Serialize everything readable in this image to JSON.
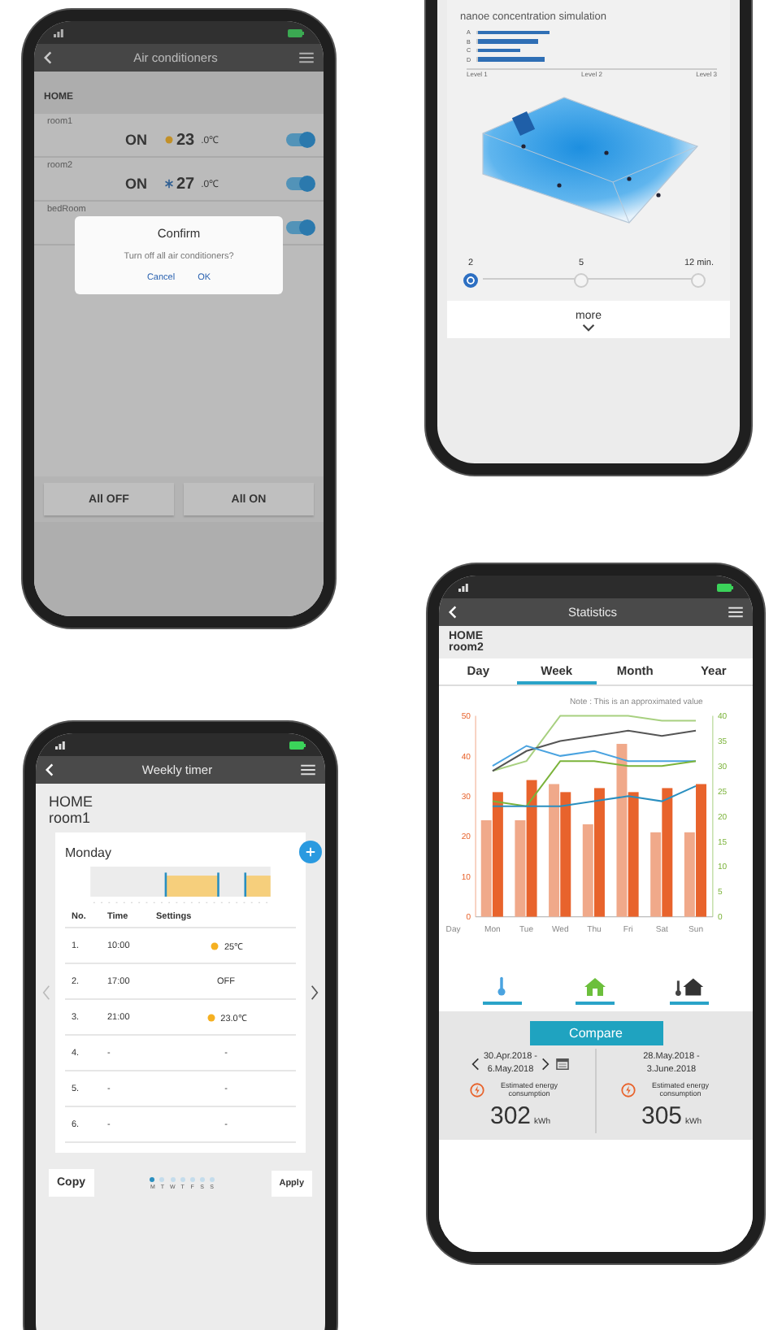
{
  "air_conditioners_screen": {
    "title": "Air conditioners",
    "group": "HOME",
    "rooms": [
      {
        "name": "room1",
        "status": "ON",
        "kind": "heat",
        "temp": "23",
        "temp_decimal": ".0℃",
        "on": true
      },
      {
        "name": "room2",
        "status": "ON",
        "kind": "cool",
        "temp": "27",
        "temp_decimal": ".0℃",
        "on": true
      },
      {
        "name": "bedRoom",
        "on": true
      }
    ],
    "dialog": {
      "title": "Confirm",
      "message": "Turn off all air conditioners?",
      "buttons": [
        "Cancel",
        "OK"
      ]
    },
    "buttons": [
      "All OFF",
      "All ON"
    ]
  },
  "simulation_screen": {
    "title": "nanoe concentration simulation",
    "bars": [
      {
        "label": "A",
        "level": 0.3
      },
      {
        "label": "B",
        "level": 0.25
      },
      {
        "label": "C",
        "level": 0.18
      },
      {
        "label": "D",
        "level": 0.28
      }
    ],
    "axis_labels": [
      "Level 1",
      "Level 2",
      "Level 3"
    ],
    "time_stops": [
      {
        "label": "2",
        "selected": true
      },
      {
        "label": "5",
        "selected": false
      },
      {
        "label": "12 min.",
        "selected": false
      }
    ],
    "more": "more"
  },
  "statistics_screen": {
    "title": "Statistics",
    "group": "HOME",
    "room": "room2",
    "tabs": [
      {
        "label": "Day",
        "selected": false
      },
      {
        "label": "Week",
        "selected": true
      },
      {
        "label": "Month",
        "selected": false
      },
      {
        "label": "Year",
        "selected": false
      }
    ],
    "chart_data": {
      "type": "bar",
      "stacked": false,
      "xlabel": "Day",
      "categories": [
        "Mon",
        "Tue",
        "Wed",
        "Thu",
        "Fri",
        "Sat",
        "Sun"
      ],
      "ylim": [
        0,
        50
      ],
      "yticks": [
        0,
        10,
        20,
        30,
        40,
        50
      ],
      "y2lim": [
        0,
        40
      ],
      "y2ticks": [
        0,
        5,
        10,
        15,
        20,
        25,
        30,
        35,
        40
      ],
      "annotations": [
        "Note : This is an approximated value"
      ],
      "series": [
        {
          "type": "bar",
          "color": "#f0a98a",
          "values": [
            24,
            24,
            33,
            23,
            43,
            21,
            21
          ]
        },
        {
          "type": "bar",
          "color": "#e8632c",
          "values": [
            31,
            34,
            31,
            32,
            31,
            32,
            33
          ]
        },
        {
          "type": "line",
          "axis": "y2",
          "color": "#a8d080",
          "values": [
            29,
            31,
            40,
            40,
            40,
            39,
            39
          ]
        },
        {
          "type": "line",
          "axis": "y2",
          "color": "#555555",
          "values": [
            29,
            33,
            35,
            36,
            37,
            36,
            37
          ]
        },
        {
          "type": "line",
          "axis": "y2",
          "color": "#4aa3e0",
          "values": [
            30,
            34,
            32,
            33,
            31,
            31,
            31
          ]
        },
        {
          "type": "line",
          "axis": "y2",
          "color": "#7bb33a",
          "values": [
            23,
            22,
            31,
            31,
            30,
            30,
            31
          ]
        },
        {
          "type": "line",
          "axis": "y2",
          "color": "#2a8fc0",
          "values": [
            22,
            22,
            22,
            23,
            24,
            23,
            26
          ]
        }
      ]
    },
    "filters": [
      {
        "kind": "thermometer"
      },
      {
        "kind": "house"
      },
      {
        "kind": "thermo-house"
      }
    ],
    "compare": "Compare",
    "periods": [
      {
        "range_start": "30.Apr.2018 -",
        "range_end": "6.May.2018",
        "kind": "navigable",
        "label": "Estimated energy consumption",
        "value": "302",
        "unit": "kWh"
      },
      {
        "range_start": "28.May.2018 -",
        "range_end": "3.June.2018",
        "kind": "fixed",
        "label": "Estimated energy consumption",
        "value": "305",
        "unit": "kWh"
      }
    ]
  },
  "weekly_timer_screen": {
    "title": "Weekly timer",
    "group": "HOME",
    "room": "room1",
    "day": "Monday",
    "columns": [
      "No.",
      "Time",
      "Settings"
    ],
    "rows": [
      {
        "no": "1.",
        "time": "10:00",
        "setting": "25℃",
        "kind": "heat"
      },
      {
        "no": "2.",
        "time": "17:00",
        "setting": "OFF",
        "kind": "plain"
      },
      {
        "no": "3.",
        "time": "21:00",
        "setting": "23.0℃",
        "kind": "heat"
      },
      {
        "no": "4.",
        "time": "-",
        "setting": "-",
        "kind": "plain"
      },
      {
        "no": "5.",
        "time": "-",
        "setting": "-",
        "kind": "plain"
      },
      {
        "no": "6.",
        "time": "-",
        "setting": "-",
        "kind": "plain"
      }
    ],
    "copy": "Copy",
    "apply": "Apply",
    "days": [
      {
        "label": "M",
        "selected": true
      },
      {
        "label": "T",
        "selected": false
      },
      {
        "label": "W",
        "selected": false
      },
      {
        "label": "T",
        "selected": false
      },
      {
        "label": "F",
        "selected": false
      },
      {
        "label": "S",
        "selected": false
      },
      {
        "label": "S",
        "selected": false
      }
    ]
  }
}
